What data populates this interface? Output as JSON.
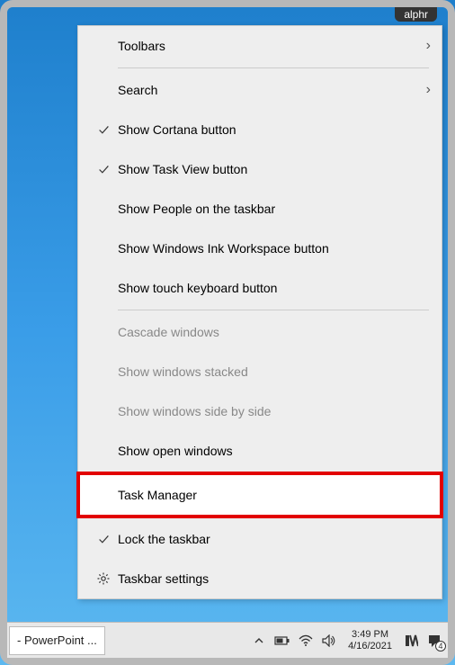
{
  "watermark": "alphr",
  "menu": {
    "toolbars": "Toolbars",
    "search": "Search",
    "show_cortana": "Show Cortana button",
    "show_task_view": "Show Task View button",
    "show_people": "Show People on the taskbar",
    "show_ink": "Show Windows Ink Workspace button",
    "show_touch_keyboard": "Show touch keyboard button",
    "cascade": "Cascade windows",
    "stacked": "Show windows stacked",
    "side_by_side": "Show windows side by side",
    "open_windows": "Show open windows",
    "task_manager": "Task Manager",
    "lock_taskbar": "Lock the taskbar",
    "taskbar_settings": "Taskbar settings"
  },
  "taskbar": {
    "app": "- PowerPoint ...",
    "clock_time": "3:49 PM",
    "clock_date": "4/16/2021",
    "notif_count": "4"
  }
}
